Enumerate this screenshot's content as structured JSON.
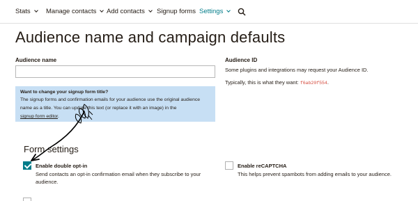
{
  "nav": {
    "items": [
      {
        "label": "Stats",
        "dropdown": true
      },
      {
        "label": "Manage contacts",
        "dropdown": true
      },
      {
        "label": "Add contacts",
        "dropdown": true
      },
      {
        "label": "Signup forms",
        "dropdown": false
      },
      {
        "label": "Settings",
        "dropdown": true,
        "active": true
      }
    ],
    "search_icon": "search-icon"
  },
  "page": {
    "title": "Audience name and campaign defaults"
  },
  "audience_name": {
    "label": "Audience name",
    "value": ""
  },
  "info_box": {
    "title": "Want to change your signup form title?",
    "body": "The signup forms and confirmation emails for your audience use the original audience name as a title. You can update this text (or replace it with an image) in the",
    "link": "signup form editor",
    "tail": "."
  },
  "audience_id": {
    "label": "Audience ID",
    "text": "Some plugins and integrations may request your Audience ID.",
    "typical_prefix": "Typically, this is what they want: ",
    "id_value": "f6ab20f554",
    "typical_suffix": "."
  },
  "form_settings": {
    "heading": "Form settings",
    "options": [
      {
        "label": "Enable double opt-in",
        "description": "Send contacts an opt-in confirmation email when they subscribe to your audience.",
        "checked": true
      },
      {
        "label": "Enable reCAPTCHA",
        "description": "This helps prevent spambots from adding emails to your audience.",
        "checked": false
      }
    ]
  },
  "colors": {
    "accent": "#007c89",
    "info_bg": "#c7dff4",
    "id_text": "#d4493b"
  }
}
